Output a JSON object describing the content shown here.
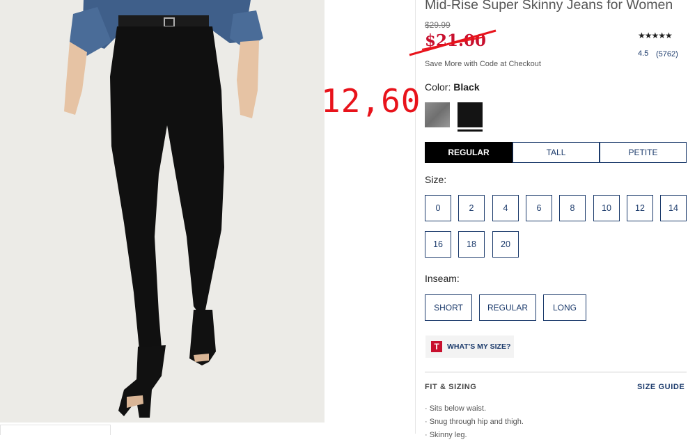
{
  "product": {
    "title": "Mid-Rise Super Skinny Jeans for Women",
    "original_price": "$29.99",
    "sale_price": "$21.00",
    "promo_text": "Save More with Code at Checkout",
    "annotation": "12,60"
  },
  "rating": {
    "stars": "★★★★★",
    "value": "4.5",
    "count": "(5762)"
  },
  "color": {
    "label": "Color:",
    "selected": "Black",
    "swatches": [
      "gray-swatch",
      "black-swatch"
    ]
  },
  "fit": {
    "tabs": [
      "REGULAR",
      "TALL",
      "PETITE"
    ],
    "selected": "REGULAR"
  },
  "size": {
    "label": "Size:",
    "options": [
      "0",
      "2",
      "4",
      "6",
      "8",
      "10",
      "12",
      "14",
      "16",
      "18",
      "20"
    ]
  },
  "inseam": {
    "label": "Inseam:",
    "options": [
      "SHORT",
      "REGULAR",
      "LONG"
    ]
  },
  "whats_my_size": {
    "logo": "T",
    "label": "WHAT'S MY SIZE?"
  },
  "fit_sizing": {
    "heading": "FIT & SIZING",
    "size_guide": "SIZE GUIDE",
    "bullets": [
      "· Sits below waist.",
      "· Snug through hip and thigh.",
      "· Skinny leg."
    ]
  },
  "colors": {
    "sale": "#c8102e",
    "navy": "#1b3a6b",
    "annotation_red": "#e8131b"
  }
}
